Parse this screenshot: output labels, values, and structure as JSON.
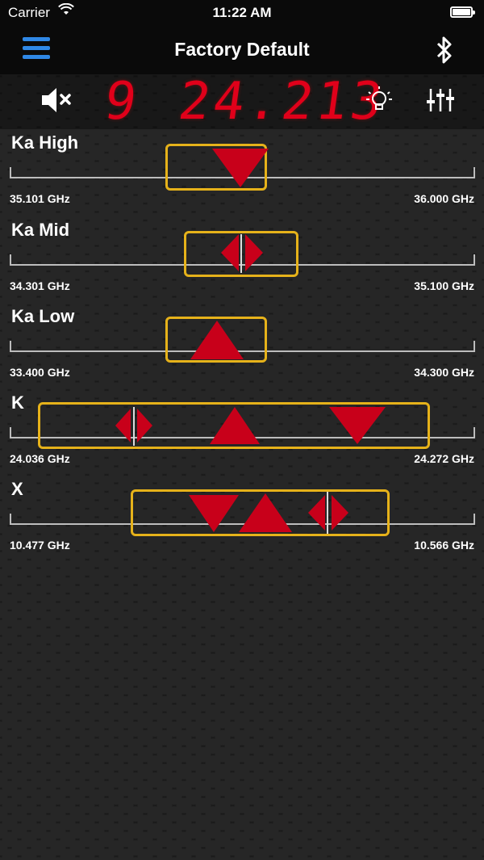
{
  "status_bar": {
    "carrier": "Carrier",
    "time": "11:22 AM"
  },
  "nav": {
    "title": "Factory Default",
    "menu_icon": "hamburger-menu-icon",
    "bluetooth_icon": "bluetooth-icon"
  },
  "display": {
    "band_digit": "9",
    "frequency": "24.213",
    "mute_icon": "speaker-mute-icon",
    "light_icon": "lightbulb-icon",
    "settings_icon": "sliders-icon",
    "digit_color": "#e0001a"
  },
  "bands": [
    {
      "name": "Ka High",
      "low": "35.101 GHz",
      "high": "36.000 GHz"
    },
    {
      "name": "Ka Mid",
      "low": "34.301 GHz",
      "high": "35.100 GHz"
    },
    {
      "name": "Ka Low",
      "low": "33.400 GHz",
      "high": "34.300 GHz"
    },
    {
      "name": "K",
      "low": "24.036 GHz",
      "high": "24.272 GHz"
    },
    {
      "name": "X",
      "low": "10.477 GHz",
      "high": "10.566 GHz"
    }
  ],
  "colors": {
    "accent_blue": "#2f88e6",
    "window_yellow": "#e6b21a",
    "marker_red": "#c8001a"
  }
}
